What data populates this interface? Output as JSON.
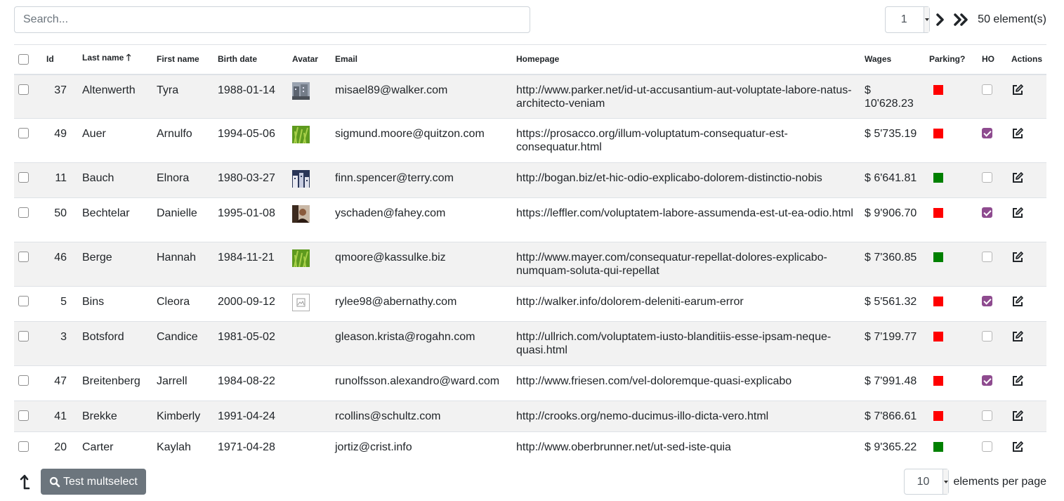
{
  "search": {
    "placeholder": "Search..."
  },
  "pager": {
    "current_page": "1",
    "total_label": "50 element(s)"
  },
  "columns": {
    "id": "Id",
    "last_name": "Last name",
    "sort_arrow": "🡑",
    "first_name": "First name",
    "birth_date": "Birth date",
    "avatar": "Avatar",
    "email": "Email",
    "homepage": "Homepage",
    "wages": "Wages",
    "parking": "Parking?",
    "ho": "HO",
    "actions": "Actions"
  },
  "rows": [
    {
      "id": "37",
      "last": "Altenwerth",
      "first": "Tyra",
      "birth": "1988-01-14",
      "avatar": "building",
      "email": "misael89@walker.com",
      "homepage": "http://www.parker.net/id-ut-accusantium-aut-voluptate-labore-natus-architecto-veniam",
      "wages": "$ 10'628.23",
      "parking": "red",
      "ho": false
    },
    {
      "id": "49",
      "last": "Auer",
      "first": "Arnulfo",
      "birth": "1994-05-06",
      "avatar": "grass",
      "email": "sigmund.moore@quitzon.com",
      "homepage": "https://prosacco.org/illum-voluptatum-consequatur-est-consequatur.html",
      "wages": "$ 5'735.19",
      "parking": "red",
      "ho": true
    },
    {
      "id": "11",
      "last": "Bauch",
      "first": "Elnora",
      "birth": "1980-03-27",
      "avatar": "city",
      "email": "finn.spencer@terry.com",
      "homepage": "http://bogan.biz/et-hic-odio-explicabo-dolorem-distinctio-nobis",
      "wages": "$ 6'641.81",
      "parking": "green",
      "ho": false
    },
    {
      "id": "50",
      "last": "Bechtelar",
      "first": "Danielle",
      "birth": "1995-01-08",
      "avatar": "person",
      "email": "yschaden@fahey.com",
      "homepage": "https://leffler.com/voluptatem-labore-assumenda-est-ut-ea-odio.html",
      "wages": "$ 9'906.70",
      "parking": "red",
      "ho": true
    },
    {
      "id": "46",
      "last": "Berge",
      "first": "Hannah",
      "birth": "1984-11-21",
      "avatar": "grass",
      "email": "qmoore@kassulke.biz",
      "homepage": "http://www.mayer.com/consequatur-repellat-dolores-explicabo-numquam-soluta-qui-repellat",
      "wages": "$ 7'360.85",
      "parking": "green",
      "ho": false
    },
    {
      "id": "5",
      "last": "Bins",
      "first": "Cleora",
      "birth": "2000-09-12",
      "avatar": "broken",
      "email": "rylee98@abernathy.com",
      "homepage": "http://walker.info/dolorem-deleniti-earum-error",
      "wages": "$ 5'561.32",
      "parking": "red",
      "ho": true
    },
    {
      "id": "3",
      "last": "Botsford",
      "first": "Candice",
      "birth": "1981-05-02",
      "avatar": "",
      "email": "gleason.krista@rogahn.com",
      "homepage": "http://ullrich.com/voluptatem-iusto-blanditiis-esse-ipsam-neque-quasi.html",
      "wages": "$ 7'199.77",
      "parking": "red",
      "ho": false
    },
    {
      "id": "47",
      "last": "Breitenberg",
      "first": "Jarrell",
      "birth": "1984-08-22",
      "avatar": "",
      "email": "runolfsson.alexandro@ward.com",
      "homepage": "http://www.friesen.com/vel-doloremque-quasi-explicabo",
      "wages": "$ 7'991.48",
      "parking": "red",
      "ho": true
    },
    {
      "id": "41",
      "last": "Brekke",
      "first": "Kimberly",
      "birth": "1991-04-24",
      "avatar": "",
      "email": "rcollins@schultz.com",
      "homepage": "http://crooks.org/nemo-ducimus-illo-dicta-vero.html",
      "wages": "$ 7'866.61",
      "parking": "red",
      "ho": false
    },
    {
      "id": "20",
      "last": "Carter",
      "first": "Kaylah",
      "birth": "1971-04-28",
      "avatar": "",
      "email": "jortiz@crist.info",
      "homepage": "http://www.oberbrunner.net/ut-sed-iste-quia",
      "wages": "$ 9'365.22",
      "parking": "green",
      "ho": false
    }
  ],
  "footer": {
    "multiselect_label": "Test multselect",
    "per_page": "10",
    "per_page_label": "elements per page"
  },
  "colors": {
    "parking_red": "#ff0000",
    "parking_green": "#008000",
    "ho_checked": "#8e4b8f",
    "button_gray": "#6c757d",
    "row_stripe": "#f2f2f2"
  },
  "icons": {
    "next": "chevron-right-icon",
    "last": "double-chevron-right-icon",
    "edit": "edit-icon",
    "scroll_top": "arrow-up-icon",
    "search": "search-icon"
  }
}
